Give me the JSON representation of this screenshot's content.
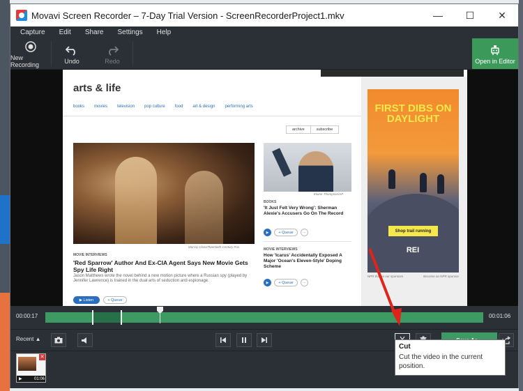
{
  "window": {
    "title": "Movavi Screen Recorder – 7-Day Trial Version - ScreenRecorderProject1.mkv",
    "minimize": "—",
    "maximize": "☐",
    "close": "✕"
  },
  "menu": [
    "Capture",
    "Edit",
    "Share",
    "Settings",
    "Help"
  ],
  "toolbar": {
    "new_recording": "New Recording",
    "undo": "Undo",
    "redo": "Redo",
    "open_editor": "Open in Editor"
  },
  "webpage": {
    "brand": "arts & life",
    "nav": [
      "books",
      "movies",
      "television",
      "pop culture",
      "food",
      "art & design",
      "performing arts"
    ],
    "pills": [
      "archive",
      "subscribe"
    ],
    "main_caption": "Murray Close/Twentieth Century Fox",
    "main_kicker": "MOVIE INTERVIEWS",
    "main_headline": "'Red Sparrow' Author And Ex-CIA Agent Says New Movie Gets Spy Life Right",
    "main_summary": "Jason Matthews wrote the novel behind a new motion picture where a Russian spy (played by Jennifer Lawrence) is trained in the dual arts of seduction and espionage.",
    "listen": "▶ Listen",
    "queue": "+ Queue",
    "side_caption": "Elaine Thompson/AP",
    "story2_kicker": "BOOKS",
    "story2_headline": "'It Just Felt Very Wrong': Sherman Alexie's Accusers Go On The Record",
    "story3_kicker": "MOVIE INTERVIEWS",
    "story3_headline": "How 'Icarus' Accidentally Exposed A Major 'Ocean's Eleven-Style' Doping Scheme",
    "ad_text": "FIRST DIBS ON DAYLIGHT",
    "ad_button": "Shop trail running",
    "ad_brand": "REI",
    "ad_foot_left": "NPR thanks our sponsors",
    "ad_foot_right": "Become an NPR sponsor"
  },
  "timeline": {
    "start_time": "00:00:17",
    "end_time": "00:01:06"
  },
  "controls": {
    "recent_label": "Recent ▲",
    "save_as": "Save As..."
  },
  "recent_item": {
    "duration": "01:06"
  },
  "tooltip": {
    "title": "Cut",
    "description": "Cut the video in the current position."
  },
  "colors": {
    "accent_green": "#3d9a63",
    "window_dark": "#2b2f36",
    "arrow_red": "#e0241b"
  }
}
